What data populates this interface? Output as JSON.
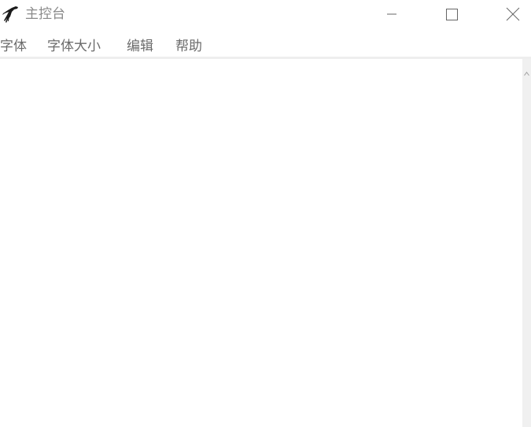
{
  "window": {
    "title": "主控台",
    "app_icon": "dinosaur-icon",
    "controls": {
      "minimize_icon": "minimize-icon",
      "maximize_icon": "maximize-icon",
      "close_icon": "close-icon"
    }
  },
  "menubar": {
    "items": [
      {
        "label": "字体"
      },
      {
        "label": "字体大小"
      },
      {
        "label": "编辑"
      },
      {
        "label": "帮助"
      }
    ]
  },
  "editor": {
    "content": ""
  },
  "colors": {
    "background": "#ffffff",
    "title_text": "#8a8a8a",
    "menu_text": "#6b6b6b",
    "scrollbar_track": "#f0f0f0",
    "separator": "#eeeeee"
  }
}
